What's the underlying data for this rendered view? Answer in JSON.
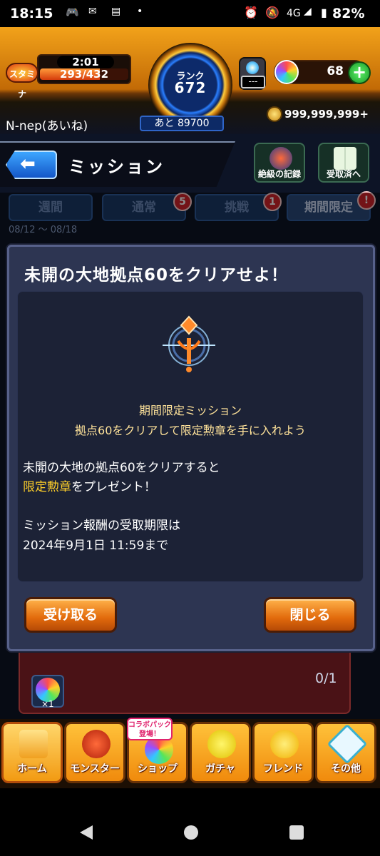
{
  "statusbar": {
    "time": "18:15",
    "network": "4G",
    "battery": "82%"
  },
  "stamina": {
    "label": "スタミナ",
    "timer": "2:01",
    "value": "293/432",
    "fill": 0.678
  },
  "rank": {
    "label": "ランク",
    "value": "672",
    "next": "あと 89700"
  },
  "player": {
    "name": "N-nep(あいね)"
  },
  "energy": {
    "value": "---"
  },
  "orbs": {
    "count": "68",
    "plus": "+"
  },
  "coins": {
    "value": "999,999,999+"
  },
  "header": {
    "title": "ミッション",
    "back_icon": "back-arrow-icon"
  },
  "side_buttons": [
    {
      "label": "絶級の記録",
      "icon": "record-emblem-icon"
    },
    {
      "label": "受取済へ",
      "icon": "book-icon"
    }
  ],
  "tabs": [
    {
      "label": "週間",
      "badge": ""
    },
    {
      "label": "通常",
      "badge": "5"
    },
    {
      "label": "挑戦",
      "badge": "1"
    },
    {
      "label": "期間限定",
      "badge": "!"
    }
  ],
  "date_range": "08/12 ～ 08/18",
  "modal": {
    "title": "未開の大地拠点60をクリアせよ！",
    "subtitle1": "期間限定ミッション",
    "subtitle2": "拠点60をクリアして限定勲章を手に入れよう",
    "body1": "未開の大地の拠点60をクリアすると",
    "body2_highlight": "限定勲章",
    "body2_rest": "をプレゼント！",
    "body3": "ミッション報酬の受取期限は",
    "body4": "2024年9月1日 11:59まで",
    "receive_button": "受け取る",
    "close_button": "閉じる"
  },
  "list_item": {
    "reward_qty": "×1",
    "progress": "0/1"
  },
  "nav": [
    {
      "label": "ホーム",
      "icon": "castle-icon"
    },
    {
      "label": "モンスター",
      "icon": "dragon-icon"
    },
    {
      "label": "ショップ",
      "icon": "orb-icon"
    },
    {
      "label": "ガチャ",
      "icon": "gacha-balloon-icon"
    },
    {
      "label": "フレンド",
      "icon": "friends-balloon-icon"
    },
    {
      "label": "その他",
      "icon": "other-icon"
    }
  ],
  "shop_tag": "コラボパック\n登場！",
  "colors": {
    "accent": "#f59a14",
    "badge": "#d1242a",
    "highlight": "#ffd02a",
    "tab": "#1b3a66"
  }
}
